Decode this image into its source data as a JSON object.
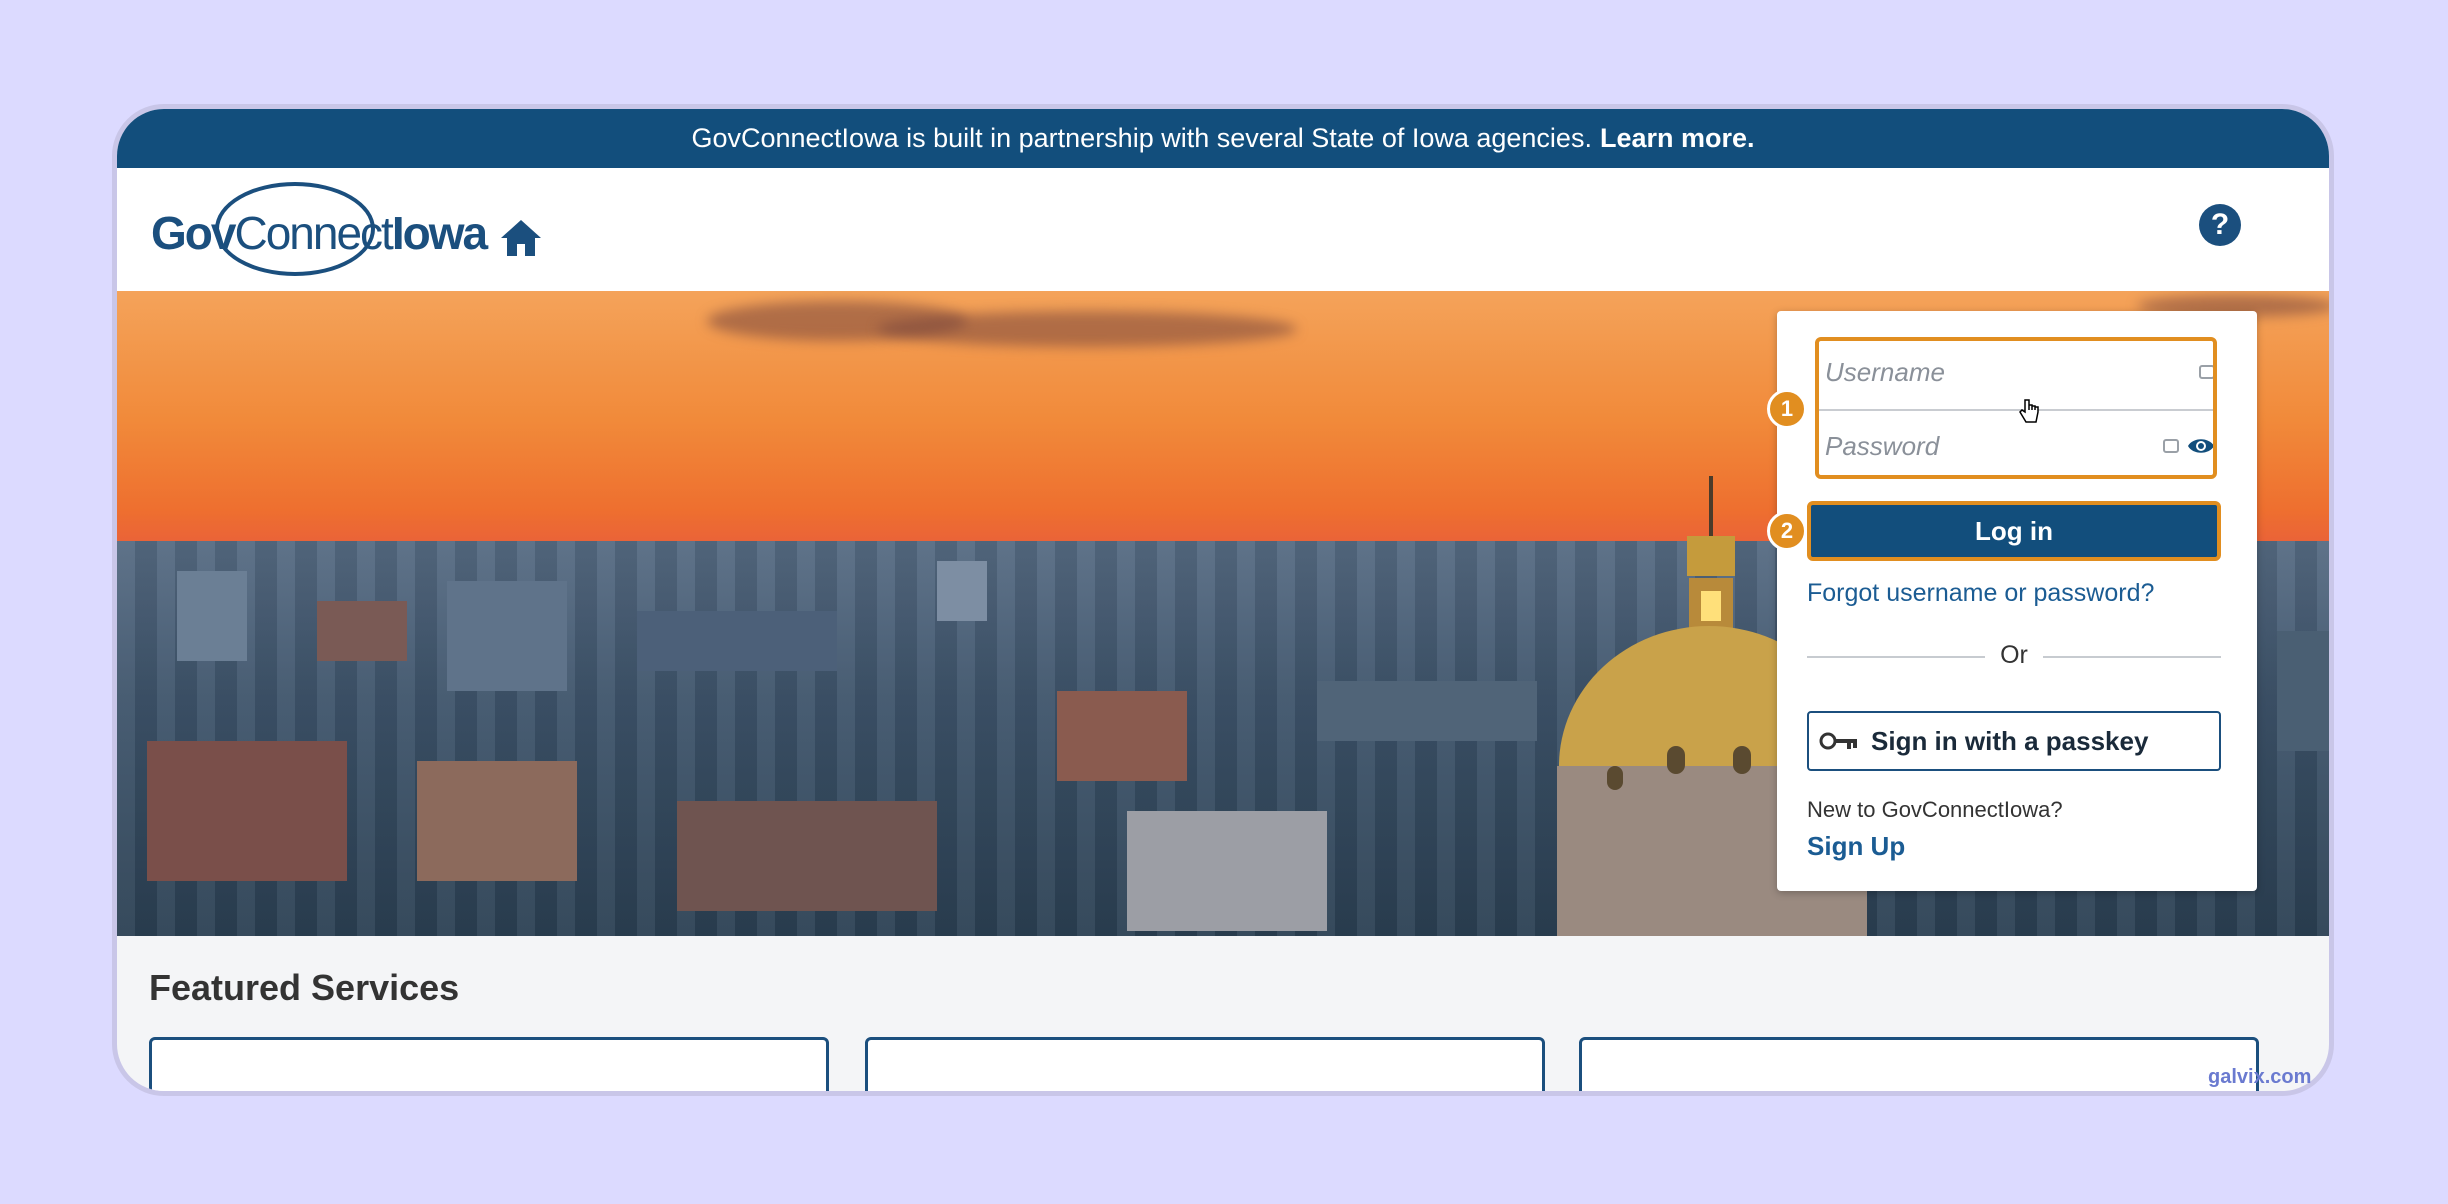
{
  "banner": {
    "text": "GovConnectIowa is built in partnership with several State of Iowa agencies.",
    "link": "Learn more."
  },
  "header": {
    "logo_prefix": "Gov",
    "logo_mid": "Connect",
    "logo_suffix": "Iowa",
    "home_icon": "home-icon",
    "help_icon": "help-circle-icon",
    "help_glyph": "?"
  },
  "login": {
    "username_placeholder": "Username",
    "password_placeholder": "Password",
    "login_label": "Log in",
    "forgot_label": "Forgot username or password?",
    "or_label": "Or",
    "passkey_label": "Sign in with a passkey",
    "new_to_label": "New to GovConnectIowa?",
    "signup_label": "Sign Up",
    "step1": "1",
    "step2": "2"
  },
  "featured": {
    "title": "Featured Services"
  },
  "watermark": "galvix.com",
  "colors": {
    "brand": "#124e7c",
    "highlight": "#e18e20",
    "link": "#1b5c93"
  }
}
